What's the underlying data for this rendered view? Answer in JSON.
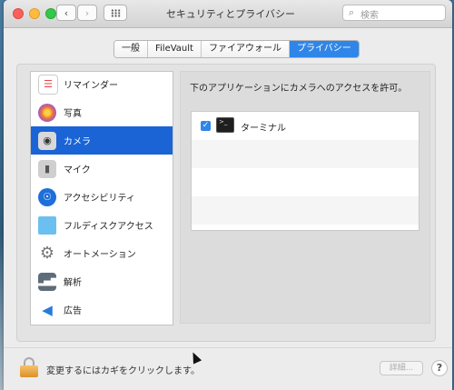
{
  "window": {
    "title": "セキュリティとプライバシー",
    "search_placeholder": "検索",
    "search_icon": "magnifier-icon",
    "back_symbol": "‹",
    "forward_symbol": "›"
  },
  "tabs": [
    {
      "label": "一般",
      "selected": false
    },
    {
      "label": "FileVault",
      "selected": false
    },
    {
      "label": "ファイアウォール",
      "selected": false
    },
    {
      "label": "プライバシー",
      "selected": true
    }
  ],
  "sidebar": {
    "items": [
      {
        "label": "リマインダー",
        "icon": "reminders-icon",
        "selected": false
      },
      {
        "label": "写真",
        "icon": "photos-icon",
        "selected": false
      },
      {
        "label": "カメラ",
        "icon": "camera-icon",
        "selected": true
      },
      {
        "label": "マイク",
        "icon": "microphone-icon",
        "selected": false
      },
      {
        "label": "アクセシビリティ",
        "icon": "accessibility-icon",
        "selected": false
      },
      {
        "label": "フルディスクアクセス",
        "icon": "folder-icon",
        "selected": false
      },
      {
        "label": "オートメーション",
        "icon": "gear-icon",
        "selected": false
      },
      {
        "label": "解析",
        "icon": "analytics-icon",
        "selected": false
      },
      {
        "label": "広告",
        "icon": "megaphone-icon",
        "selected": false
      }
    ]
  },
  "main": {
    "heading": "下のアプリケーションにカメラへのアクセスを許可。",
    "apps": [
      {
        "name": "ターミナル",
        "checked": true,
        "icon": "terminal-icon"
      }
    ]
  },
  "footer": {
    "lock_text": "変更するにはカギをクリックします。",
    "advanced_label": "詳細...",
    "help_label": "?"
  },
  "colors": {
    "accent": "#2f86e8",
    "selection": "#1a64d6"
  }
}
